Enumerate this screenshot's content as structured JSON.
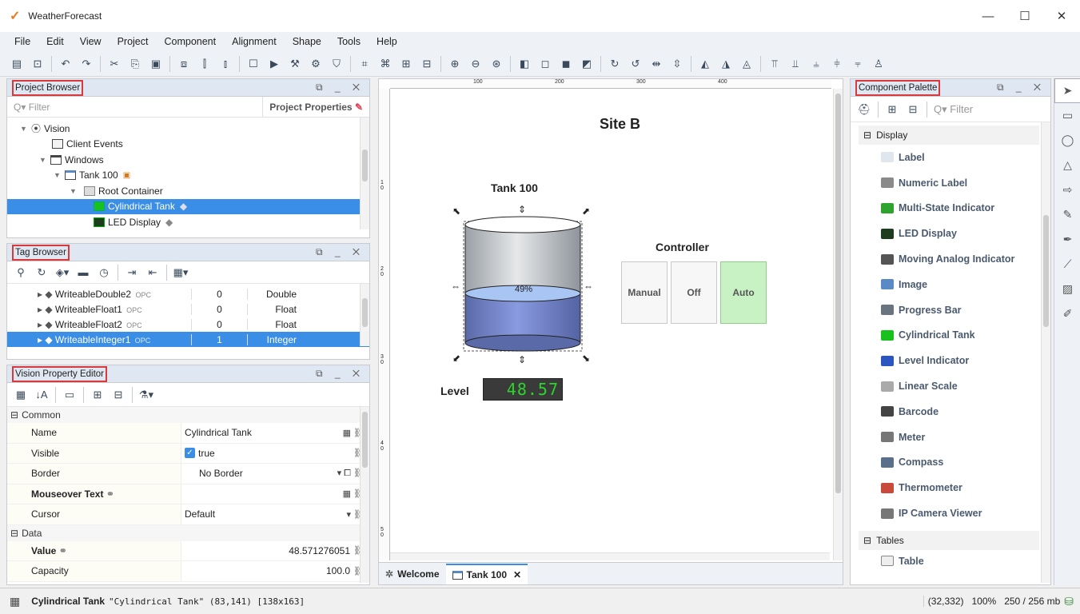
{
  "window": {
    "title": "WeatherForecast",
    "minimize": "—",
    "maximize": "☐",
    "close": "✕"
  },
  "menu": [
    "File",
    "Edit",
    "View",
    "Project",
    "Component",
    "Alignment",
    "Shape",
    "Tools",
    "Help"
  ],
  "project_browser": {
    "title": "Project Browser",
    "filter_placeholder": "Filter",
    "project_properties": "Project Properties",
    "tree": [
      {
        "label": "Vision",
        "indent": 1
      },
      {
        "label": "Client Events",
        "indent": 2
      },
      {
        "label": "Windows",
        "indent": 2
      },
      {
        "label": "Tank 100",
        "indent": 3
      },
      {
        "label": "Root Container",
        "indent": 4
      },
      {
        "label": "Cylindrical Tank",
        "indent": 5,
        "selected": true
      },
      {
        "label": "LED Display",
        "indent": 5
      }
    ]
  },
  "tag_browser": {
    "title": "Tag Browser",
    "rows": [
      {
        "name": "WriteableDouble2",
        "source": "OPC",
        "value": "0",
        "type": "Double"
      },
      {
        "name": "WriteableFloat1",
        "source": "OPC",
        "value": "0",
        "type": "Float"
      },
      {
        "name": "WriteableFloat2",
        "source": "OPC",
        "value": "0",
        "type": "Float"
      },
      {
        "name": "WriteableInteger1",
        "source": "OPC",
        "value": "1",
        "type": "Integer",
        "selected": true
      }
    ]
  },
  "property_editor": {
    "title": "Vision Property Editor",
    "common_label": "Common",
    "data_label": "Data",
    "name_label": "Name",
    "name_value": "Cylindrical Tank",
    "visible_label": "Visible",
    "visible_value": "true",
    "border_label": "Border",
    "border_value": "No Border",
    "mouseover_label": "Mouseover Text",
    "cursor_label": "Cursor",
    "cursor_value": "Default",
    "value_label": "Value",
    "value_value": "48.571276051",
    "capacity_label": "Capacity",
    "capacity_value": "100.0"
  },
  "designer": {
    "site_title": "Site B",
    "tank_title": "Tank 100",
    "tank_percent": "49%",
    "tank_fill_fraction": 0.49,
    "level_label": "Level",
    "led_value": "48.57",
    "controller_title": "Controller",
    "buttons": [
      "Manual",
      "Off",
      "Auto"
    ],
    "ruler_marks": [
      "100",
      "200",
      "300",
      "400"
    ],
    "ruler_left_marks": [
      "1 0",
      "2 0",
      "3 0",
      "4 0",
      "5 0"
    ],
    "tabs": [
      {
        "label": "Welcome"
      },
      {
        "label": "Tank 100"
      }
    ],
    "tab_close": "✕"
  },
  "component_palette": {
    "title": "Component Palette",
    "filter_placeholder": "Filter",
    "display_section": "Display",
    "tables_section": "Tables",
    "items": [
      {
        "label": "Label",
        "icon": "label-icon",
        "color": "#dfe6ee"
      },
      {
        "label": "Numeric Label",
        "icon": "numeric-label-icon",
        "color": "#8a8a8a"
      },
      {
        "label": "Multi-State Indicator",
        "icon": "multistate-icon",
        "color": "#2ea32e"
      },
      {
        "label": "LED Display",
        "icon": "led-icon",
        "color": "#1e3d1e"
      },
      {
        "label": "Moving Analog Indicator",
        "icon": "moving-analog-icon",
        "color": "#555555"
      },
      {
        "label": "Image",
        "icon": "image-icon",
        "color": "#5a8ac6"
      },
      {
        "label": "Progress Bar",
        "icon": "progress-bar-icon",
        "color": "#6a7480"
      },
      {
        "label": "Cylindrical Tank",
        "icon": "cylinder-icon",
        "color": "#19c11e"
      },
      {
        "label": "Level Indicator",
        "icon": "level-indicator-icon",
        "color": "#2b55c0"
      },
      {
        "label": "Linear Scale",
        "icon": "linear-scale-icon",
        "color": "#aaaaaa"
      },
      {
        "label": "Barcode",
        "icon": "barcode-icon",
        "color": "#444444"
      },
      {
        "label": "Meter",
        "icon": "meter-icon",
        "color": "#777777"
      },
      {
        "label": "Compass",
        "icon": "compass-icon",
        "color": "#5a6f8a"
      },
      {
        "label": "Thermometer",
        "icon": "thermometer-icon",
        "color": "#c94a3a"
      },
      {
        "label": "IP Camera Viewer",
        "icon": "camera-icon",
        "color": "#777777"
      }
    ],
    "table_item": "Table"
  },
  "status": {
    "component": "Cylindrical Tank",
    "detail": "\"Cylindrical Tank\" (83,141) [138x163]",
    "coords": "(32,332)",
    "zoom": "100%",
    "memory": "250 / 256 mb"
  }
}
